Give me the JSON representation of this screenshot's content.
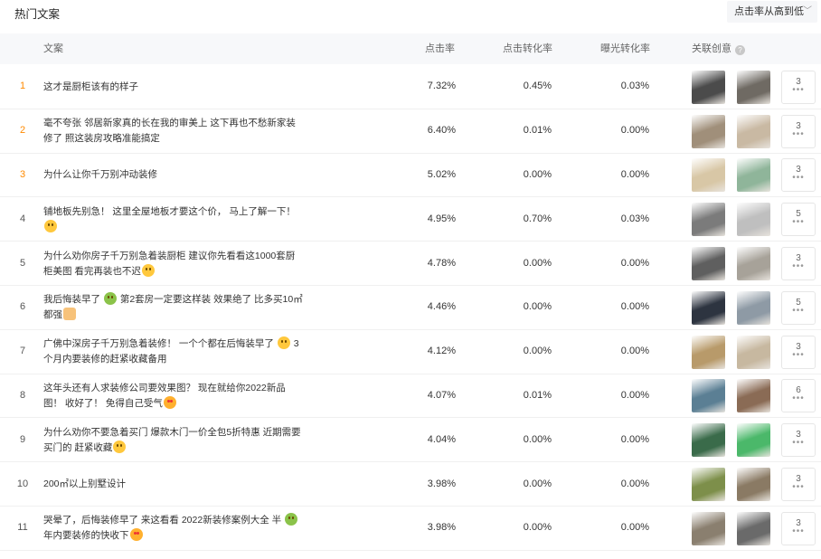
{
  "header": {
    "title": "热门文案",
    "sort_label": "点击率从高到低"
  },
  "columns": {
    "text": "文案",
    "ctr": "点击率",
    "cvr": "点击转化率",
    "exposure": "曝光转化率",
    "creative": "关联创意"
  },
  "rows": [
    {
      "rank": "1",
      "line1": "这才是厨柜该有的样子",
      "line2": "",
      "emoji1": "",
      "emoji2": "",
      "ctr": "7.32%",
      "cvr": "0.45%",
      "exp": "0.03%",
      "more": "3",
      "colors": [
        "#4b4b4b",
        "#6f6a63"
      ]
    },
    {
      "rank": "2",
      "line1": "毫不夸张 邻居新家真的长在我的审美上 这下再也不愁新家装",
      "line2": "修了 照这装房攻略准能搞定",
      "emoji1": "",
      "emoji2": "",
      "ctr": "6.40%",
      "cvr": "0.01%",
      "exp": "0.00%",
      "more": "3",
      "colors": [
        "#a08f7a",
        "#c9b9a3"
      ]
    },
    {
      "rank": "3",
      "line1": "为什么让你千万别冲动装修",
      "line2": "",
      "emoji1": "",
      "emoji2": "",
      "ctr": "5.02%",
      "cvr": "0.00%",
      "exp": "0.00%",
      "more": "3",
      "colors": [
        "#d8c7a6",
        "#8fb59a"
      ]
    },
    {
      "rank": "4",
      "line1": "铺地板先别急！ 这里全屋地板才要这个价， 马上了解一下！",
      "line2": "",
      "emoji1": "",
      "emoji2": "thinking",
      "ctr": "4.95%",
      "cvr": "0.70%",
      "exp": "0.03%",
      "more": "5",
      "colors": [
        "#7b7b7b",
        "#bfbfbf"
      ]
    },
    {
      "rank": "5",
      "line1": "为什么劝你房子千万别急着装厨柜 建议你先看看这1000套厨",
      "line2": "柜美图 看完再装也不迟",
      "emoji1": "",
      "emoji2": "thinking",
      "ctr": "4.78%",
      "cvr": "0.00%",
      "exp": "0.00%",
      "more": "3",
      "colors": [
        "#5f5f5f",
        "#a7a299"
      ]
    },
    {
      "rank": "6",
      "line1": "我后悔装早了",
      "line1b": "第2套房一定要这样装 效果绝了 比多买10㎡",
      "line2": "都强",
      "emoji1": "green",
      "emoji2": "thumb",
      "ctr": "4.46%",
      "cvr": "0.00%",
      "exp": "0.00%",
      "more": "5",
      "colors": [
        "#2d3440",
        "#8e9aa5"
      ]
    },
    {
      "rank": "7",
      "line1": "广佛中深房子千万别急着装修！ 一个个都在后悔装早了",
      "line1b": "3",
      "line2": "个月内要装修的赶紧收藏备用",
      "emoji1": "thinking",
      "emoji2": "",
      "ctr": "4.12%",
      "cvr": "0.00%",
      "exp": "0.00%",
      "more": "3",
      "colors": [
        "#b89a6a",
        "#c7b8a0"
      ]
    },
    {
      "rank": "8",
      "line1": "这年头还有人求装修公司要效果图？ 现在就给你2022新品",
      "line2": "图！ 收好了！ 免得自己受气",
      "emoji1": "",
      "emoji2": "love",
      "ctr": "4.07%",
      "cvr": "0.01%",
      "exp": "0.00%",
      "more": "6",
      "colors": [
        "#5b7f94",
        "#8a6b55"
      ]
    },
    {
      "rank": "9",
      "line1": "为什么劝你不要急着买门 爆款木门一价全包5折特惠 近期需要",
      "line2": "买门的 赶紧收藏",
      "emoji1": "",
      "emoji2": "open",
      "ctr": "4.04%",
      "cvr": "0.00%",
      "exp": "0.00%",
      "more": "3",
      "colors": [
        "#3a6b4a",
        "#4bb86a"
      ]
    },
    {
      "rank": "10",
      "line1": "200㎡以上别墅设计",
      "line2": "",
      "emoji1": "",
      "emoji2": "",
      "ctr": "3.98%",
      "cvr": "0.00%",
      "exp": "0.00%",
      "more": "3",
      "colors": [
        "#7d8f4a",
        "#8a7a64"
      ]
    },
    {
      "rank": "11",
      "line1": "哭晕了，后悔装修早了 来这看看 2022新装修案例大全 半",
      "line2": "年内要装修的快收下",
      "emoji1": "green",
      "emoji2": "love",
      "ctr": "3.98%",
      "cvr": "0.00%",
      "exp": "0.00%",
      "more": "3",
      "colors": [
        "#8a7f6f",
        "#6a6a6a"
      ]
    }
  ]
}
